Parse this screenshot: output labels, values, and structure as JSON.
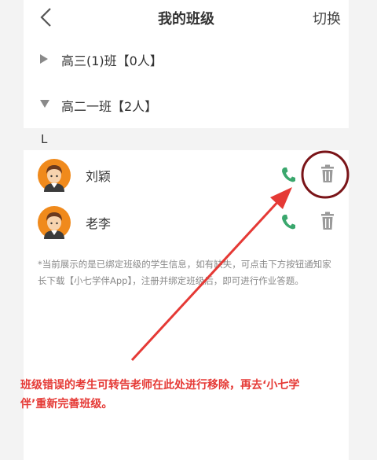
{
  "header": {
    "title": "我的班级",
    "switch_label": "切换"
  },
  "classes": [
    {
      "label": "高三(1)班【0人】",
      "expanded": false
    },
    {
      "label": "高二一班【2人】",
      "expanded": true
    }
  ],
  "group_letter": "L",
  "students": [
    {
      "name": "刘颖"
    },
    {
      "name": "老李"
    }
  ],
  "notice": "*当前展示的是已绑定班级的学生信息，如有缺失，可点击下方按钮通知家长下载【小七学伴App】，注册并绑定班级后，即可进行作业答题。",
  "annotation": "班级错误的考生可转告老师在此处进行移除，再去‘小七学伴’重新完善班级。",
  "colors": {
    "phone": "#3aa76d",
    "trash": "#9a9a9a",
    "annotation": "#e53935",
    "circle_highlight": "#7a1418"
  }
}
